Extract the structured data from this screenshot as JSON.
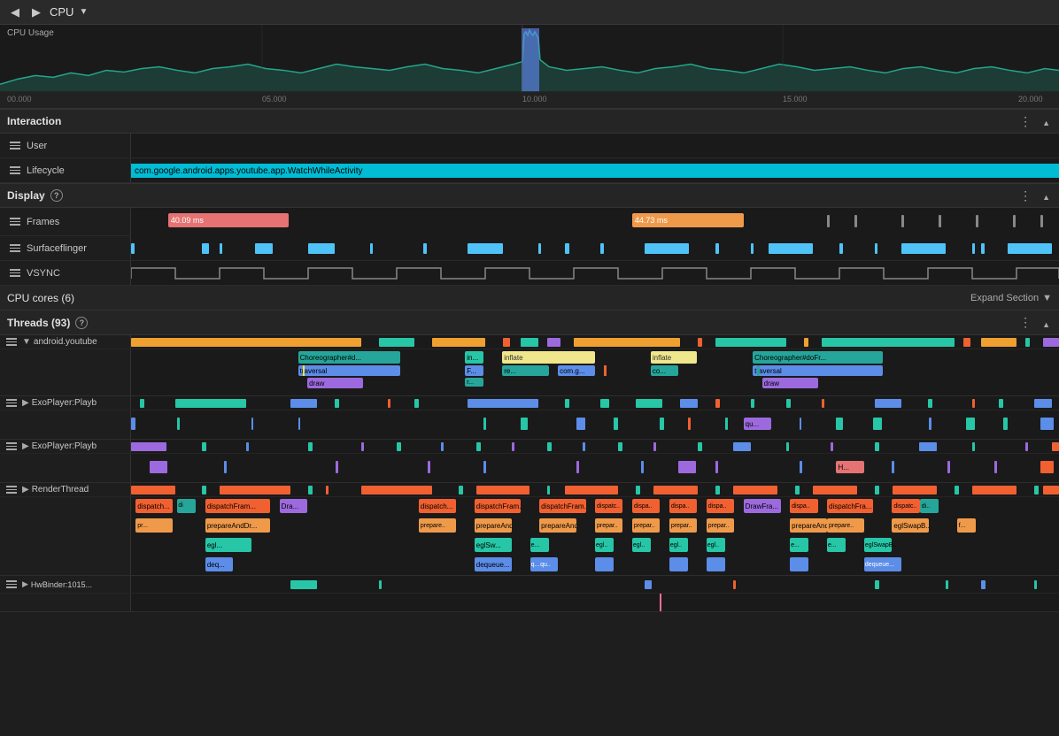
{
  "topbar": {
    "back_label": "◀",
    "forward_label": "▶",
    "title": "CPU",
    "dropdown_arrow": "▼"
  },
  "cpu_chart": {
    "label": "CPU Usage"
  },
  "timeline_ruler": {
    "ticks": [
      "00.000",
      "05.000",
      "10.000",
      "15.000",
      "20.000"
    ]
  },
  "interaction": {
    "title": "Interaction",
    "user_label": "User",
    "lifecycle_label": "Lifecycle",
    "lifecycle_value": "com.google.android.apps.youtube.app.WatchWhileActivity"
  },
  "display": {
    "title": "Display",
    "frames_label": "Frames",
    "surfaceflinger_label": "Surfaceflinger",
    "vsync_label": "VSYNC",
    "frame1_ms": "40.09 ms",
    "frame2_ms": "44.73 ms"
  },
  "cpu_cores": {
    "title": "CPU cores (6)",
    "expand_label": "Expand Section"
  },
  "threads": {
    "title": "Threads (93)",
    "items": [
      {
        "name": "android.youtube",
        "expanded": true
      },
      {
        "name": "ExoPlayer:Playb",
        "expanded": false
      },
      {
        "name": "ExoPlayer:Playb",
        "expanded": false
      },
      {
        "name": "RenderThread",
        "expanded": true
      },
      {
        "name": "HwBinder:1015...",
        "expanded": false
      }
    ]
  },
  "call_blocks": {
    "choreographer": "Choreographer#d...",
    "traversal": "traversal",
    "draw": "draw",
    "inflate": "inflate",
    "fra": "F...",
    "in": "in...",
    "r": "r...",
    "re": "re...",
    "com_g": "com.g...",
    "inflate2": "inflate",
    "co": "co...",
    "choreographer2": "Choreographer#doFr...",
    "traversal2": "traversal",
    "draw2": "draw",
    "dispatch": "dispatch...",
    "dispatchFram": "dispatchFram...",
    "dra": "Dra...",
    "prepareAndDr": "prepareAndDr...",
    "egl": "egl...",
    "prepare": "prepare...",
    "prepareAnd": "prepareAnd...",
    "eglSw": "eglSw...",
    "deq": "deq...",
    "drawFra": "DrawFra...",
    "dispatchFra2": "dispatchFra...",
    "prepareAndO": "prepareAndO...",
    "eglSwapB": "eglSwapB...",
    "dequeue": "dequeue...",
    "qu": "qu...",
    "H": "H..."
  }
}
